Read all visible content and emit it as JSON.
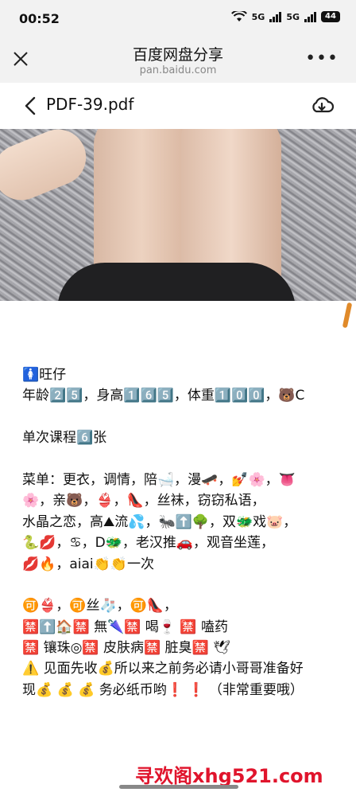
{
  "status": {
    "time": "00:52",
    "net1": "5G",
    "net2": "5G",
    "battery": "44"
  },
  "browser": {
    "title": "百度网盘分享",
    "url": "pan.baidu.com"
  },
  "file": {
    "name": "PDF-39.pdf"
  },
  "lines": [
    "🚺旺仔",
    "年龄2️⃣5️⃣，身高1️⃣6️⃣5️⃣，体重1️⃣0️⃣0️⃣，🐻C",
    "",
    "单次课程6️⃣张",
    "",
    "菜单：更衣，调情，陪🛁，漫🛹，💅🌸，👅",
    "🌸，亲🐻，👙，👠，丝袜，窃窃私语，",
    "水晶之恋，高⛰流💦，🐜⬆️🌳，双🐲戏🐷，",
    "🐍💋，♋，D🐲，老汉推🚗，观音坐莲，",
    "💋🔥，aiai👏👏一次",
    "",
    "🉑👙，🉑丝🧦，🉑👠，",
    "🈲⬆️🏠🈲 無🌂🈲 喝🍷 🈲 嗑药",
    "🈲 镶珠◎🈲 皮肤病🈲 脏臭🈲 🕊",
    "⚠️ 见面先收💰所以来之前务必请小哥哥准备好",
    "现💰 💰 💰 务必纸币哟❗ ❗ （非常重要哦）"
  ],
  "watermark": "寻欢阁xhg521.com"
}
